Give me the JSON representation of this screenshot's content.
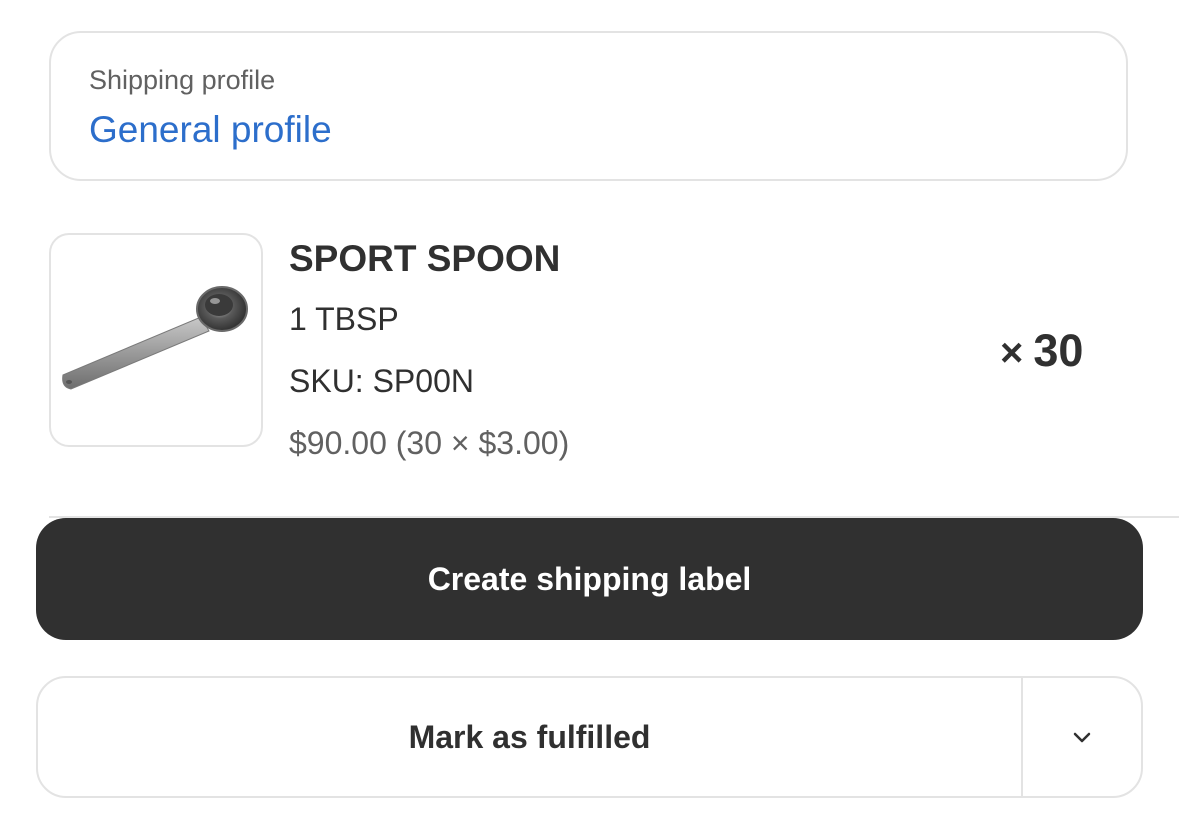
{
  "shipping_profile": {
    "label": "Shipping profile",
    "value": "General profile"
  },
  "product": {
    "title": "SPORT SPOON",
    "variant": "1 TBSP",
    "sku": "SKU: SP00N",
    "price": "$90.00 (30 × $3.00)",
    "quantity_symbol": "×",
    "quantity": "30"
  },
  "actions": {
    "primary_label": "Create shipping label",
    "secondary_label": "Mark as fulfilled"
  },
  "colors": {
    "link": "#2c6ecb",
    "primary_button": "#303030",
    "border": "#e3e3e3"
  },
  "icons": {
    "thumbnail": "measuring-spoon-image",
    "dropdown": "chevron-down-icon"
  }
}
